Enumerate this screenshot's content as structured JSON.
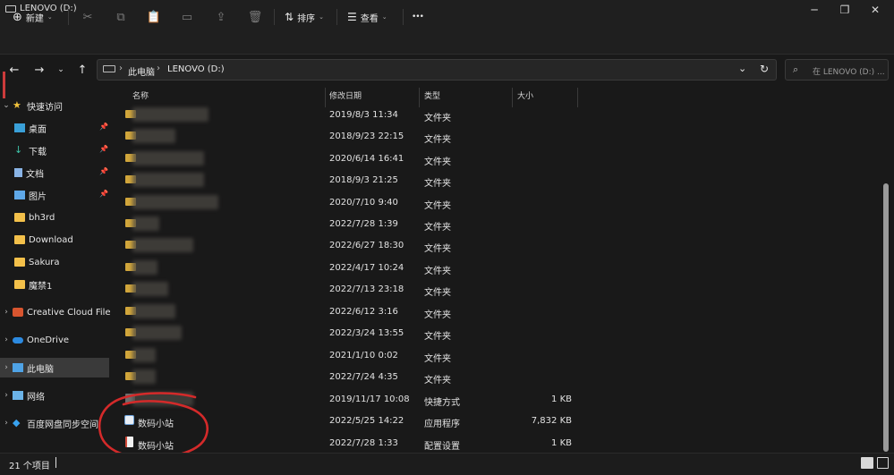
{
  "window": {
    "title": "LENOVO (D:)"
  },
  "toolbar": {
    "new_label": "新建",
    "sort_label": "排序",
    "view_label": "查看",
    "more_label": "•••"
  },
  "address": {
    "segments": [
      "此电脑",
      "LENOVO (D:)"
    ],
    "search_placeholder": "在 LENOVO (D:) ..."
  },
  "sidebar": {
    "items": [
      {
        "label": "快速访问",
        "icon": "star-icon"
      },
      {
        "label": "桌面",
        "icon": "desktop-icon",
        "pinned": true
      },
      {
        "label": "下载",
        "icon": "download-icon",
        "pinned": true
      },
      {
        "label": "文档",
        "icon": "document-icon",
        "pinned": true
      },
      {
        "label": "图片",
        "icon": "picture-icon",
        "pinned": true
      },
      {
        "label": "bh3rd",
        "icon": "folder-icon"
      },
      {
        "label": "Download",
        "icon": "folder-icon"
      },
      {
        "label": "Sakura",
        "icon": "folder-icon"
      },
      {
        "label": "魔禁1",
        "icon": "folder-icon"
      },
      {
        "label": "Creative Cloud File",
        "icon": "creative-cloud-icon"
      },
      {
        "label": "OneDrive",
        "icon": "onedrive-icon"
      },
      {
        "label": "此电脑",
        "icon": "computer-icon"
      },
      {
        "label": "网络",
        "icon": "network-icon"
      },
      {
        "label": "百度网盘同步空间",
        "icon": "baidu-netdisk-icon"
      }
    ]
  },
  "columns": {
    "name": "名称",
    "date": "修改日期",
    "type": "类型",
    "size": "大小"
  },
  "files": [
    {
      "name": "",
      "date": "2019/8/3 11:34",
      "type": "文件夹",
      "size": ""
    },
    {
      "name": "",
      "date": "2018/9/23 22:15",
      "type": "文件夹",
      "size": ""
    },
    {
      "name": "",
      "date": "2020/6/14 16:41",
      "type": "文件夹",
      "size": ""
    },
    {
      "name": "",
      "date": "2018/9/3 21:25",
      "type": "文件夹",
      "size": ""
    },
    {
      "name": "",
      "date": "2020/7/10 9:40",
      "type": "文件夹",
      "size": ""
    },
    {
      "name": "",
      "date": "2022/7/28 1:39",
      "type": "文件夹",
      "size": ""
    },
    {
      "name": "",
      "date": "2022/6/27 18:30",
      "type": "文件夹",
      "size": ""
    },
    {
      "name": "",
      "date": "2022/4/17 10:24",
      "type": "文件夹",
      "size": ""
    },
    {
      "name": "",
      "date": "2022/7/13 23:18",
      "type": "文件夹",
      "size": ""
    },
    {
      "name": "",
      "date": "2022/6/12 3:16",
      "type": "文件夹",
      "size": ""
    },
    {
      "name": "",
      "date": "2022/3/24 13:55",
      "type": "文件夹",
      "size": ""
    },
    {
      "name": "",
      "date": "2021/1/10 0:02",
      "type": "文件夹",
      "size": ""
    },
    {
      "name": "",
      "date": "2022/7/24 4:35",
      "type": "文件夹",
      "size": ""
    },
    {
      "name": "",
      "date": "2019/11/17 10:08",
      "type": "快捷方式",
      "size": "1 KB"
    },
    {
      "name": "数码小站",
      "date": "2022/5/25 14:22",
      "type": "应用程序",
      "size": "7,832 KB"
    },
    {
      "name": "数码小站",
      "date": "2022/7/28 1:33",
      "type": "配置设置",
      "size": "1 KB"
    }
  ],
  "status": {
    "item_count": "21 个项目"
  },
  "colors": {
    "annotation": "#d42a2a",
    "folder": "#f3c04a",
    "background": "#191919"
  }
}
